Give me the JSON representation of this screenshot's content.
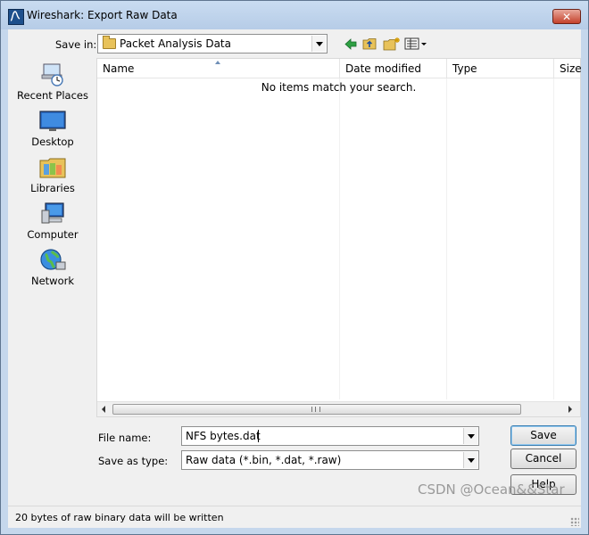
{
  "window": {
    "title": "Wireshark: Export Raw Data",
    "close_label": "✕"
  },
  "save_in": {
    "label": "Save in:",
    "label_access_key": "i",
    "value": "Packet Analysis Data"
  },
  "toolbar": {
    "icons": [
      "back-icon",
      "up-one-level-icon",
      "new-folder-icon",
      "view-menu-icon"
    ]
  },
  "places": [
    {
      "label": "Recent Places",
      "icon": "recent-places-icon"
    },
    {
      "label": "Desktop",
      "icon": "desktop-icon"
    },
    {
      "label": "Libraries",
      "icon": "libraries-icon"
    },
    {
      "label": "Computer",
      "icon": "computer-icon"
    },
    {
      "label": "Network",
      "icon": "network-icon"
    }
  ],
  "file_list": {
    "columns": [
      "Name",
      "Date modified",
      "Type",
      "Size"
    ],
    "empty_message": "No items match your search.",
    "scroll_grip": "|||"
  },
  "file_name": {
    "label": "File name:",
    "value": "NFS bytes.dat"
  },
  "save_as_type": {
    "label": "Save as type:",
    "value": "Raw data (*.bin, *.dat, *.raw)"
  },
  "buttons": {
    "save": "Save",
    "cancel": "Cancel",
    "help": "Help"
  },
  "status": {
    "text": "20 bytes of raw binary data will be written"
  },
  "watermark": "CSDN @Ocean&&Star",
  "colors": {
    "title_bar": "#c9dcf1",
    "close_button": "#c4412b",
    "accent": "#3c7fb1"
  }
}
